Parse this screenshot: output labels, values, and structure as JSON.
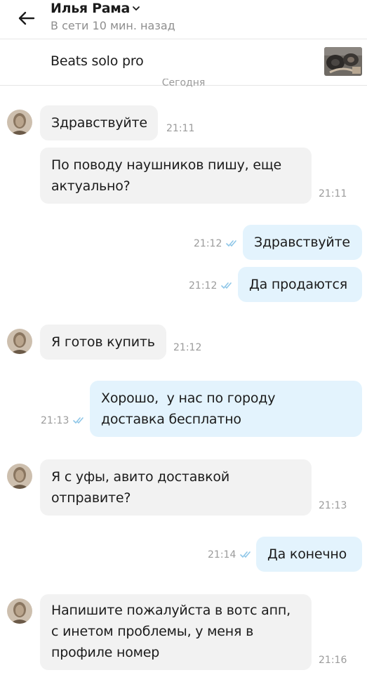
{
  "header": {
    "contact_name": "Илья Рама",
    "status": "В сети 10 мин. назад"
  },
  "item": {
    "title": "Beats solo pro"
  },
  "date_separator": "Сегодня",
  "messages": [
    {
      "direction": "in",
      "lines": [
        "Здравствуйте"
      ],
      "time": "21:11",
      "avatar": true
    },
    {
      "direction": "in",
      "lines": [
        "По поводу наушников пишу, еще",
        "актуально?"
      ],
      "time": "21:11",
      "avatar": false
    },
    {
      "direction": "out",
      "lines": [
        "Здравствуйте"
      ],
      "time": "21:12",
      "read": true
    },
    {
      "direction": "out",
      "lines": [
        "Да продаются"
      ],
      "time": "21:12",
      "read": true
    },
    {
      "direction": "in",
      "lines": [
        "Я готов купить"
      ],
      "time": "21:12",
      "avatar": true
    },
    {
      "direction": "out",
      "lines": [
        "Хорошо,  у нас по городу",
        "доставка бесплатно"
      ],
      "time": "21:13",
      "read": true
    },
    {
      "direction": "in",
      "lines": [
        "Я с уфы, авито доставкой",
        "отправите?"
      ],
      "time": "21:13",
      "avatar": true
    },
    {
      "direction": "out",
      "lines": [
        "Да конечно"
      ],
      "time": "21:14",
      "read": true
    },
    {
      "direction": "in",
      "lines": [
        "Напишите пожалуйста в вотс апп,",
        "с инетом проблемы, у меня в",
        "профиле номер"
      ],
      "time": "21:16",
      "avatar": true
    }
  ],
  "colors": {
    "incoming_bubble": "#f2f2f2",
    "outgoing_bubble": "#e3f3fd",
    "read_ticks": "#8fc7e8",
    "muted_text": "#9b9b9b"
  },
  "icons": [
    "back-arrow-icon",
    "chevron-down-icon",
    "double-check-icon"
  ]
}
